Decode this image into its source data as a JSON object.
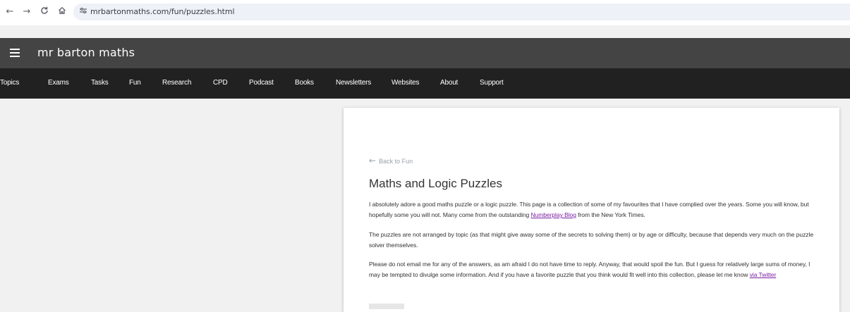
{
  "browser": {
    "url": "mrbartonmaths.com/fun/puzzles.html",
    "icons": [
      "back-arrow-icon",
      "forward-arrow-icon",
      "reload-icon",
      "home-icon",
      "site-info-icon"
    ]
  },
  "site": {
    "title": "mr barton maths",
    "nav": [
      "Topics",
      "Exams",
      "Tasks",
      "Fun",
      "Research",
      "CPD",
      "Podcast",
      "Books",
      "Newsletters",
      "Websites",
      "About",
      "Support"
    ]
  },
  "content": {
    "back_link": "Back to Fun",
    "title": "Maths and Logic Puzzles",
    "p1_a": "I absolutely adore a good maths puzzle or a logic puzzle. This page is a collection of some of my favourites that I have complied over the years. Some you will know, but hopefully some you will not. Many come from the outstanding ",
    "p1_link": "Numberplay Blog",
    "p1_b": " from the New York Times.",
    "p2": "The puzzles are not arranged by topic (as that might give away some of the secrets to solving them) or by age or difficulty, because that depends very much on the puzzle solver themselves.",
    "p3_a": "Please do not email me for any of the answers, as  am afraid I do not have time to reply. Anyway, that would spoil the fun. But I guess for relatively large sums of money, I may be tempted to divulge some information. And if you have a favorite puzzle that you think would fit well into this collection, please let me know ",
    "p3_link": "via Twitter"
  },
  "colors": {
    "header_bg": "#444444",
    "nav_bg": "#212121",
    "link": "#7b1fa2"
  }
}
